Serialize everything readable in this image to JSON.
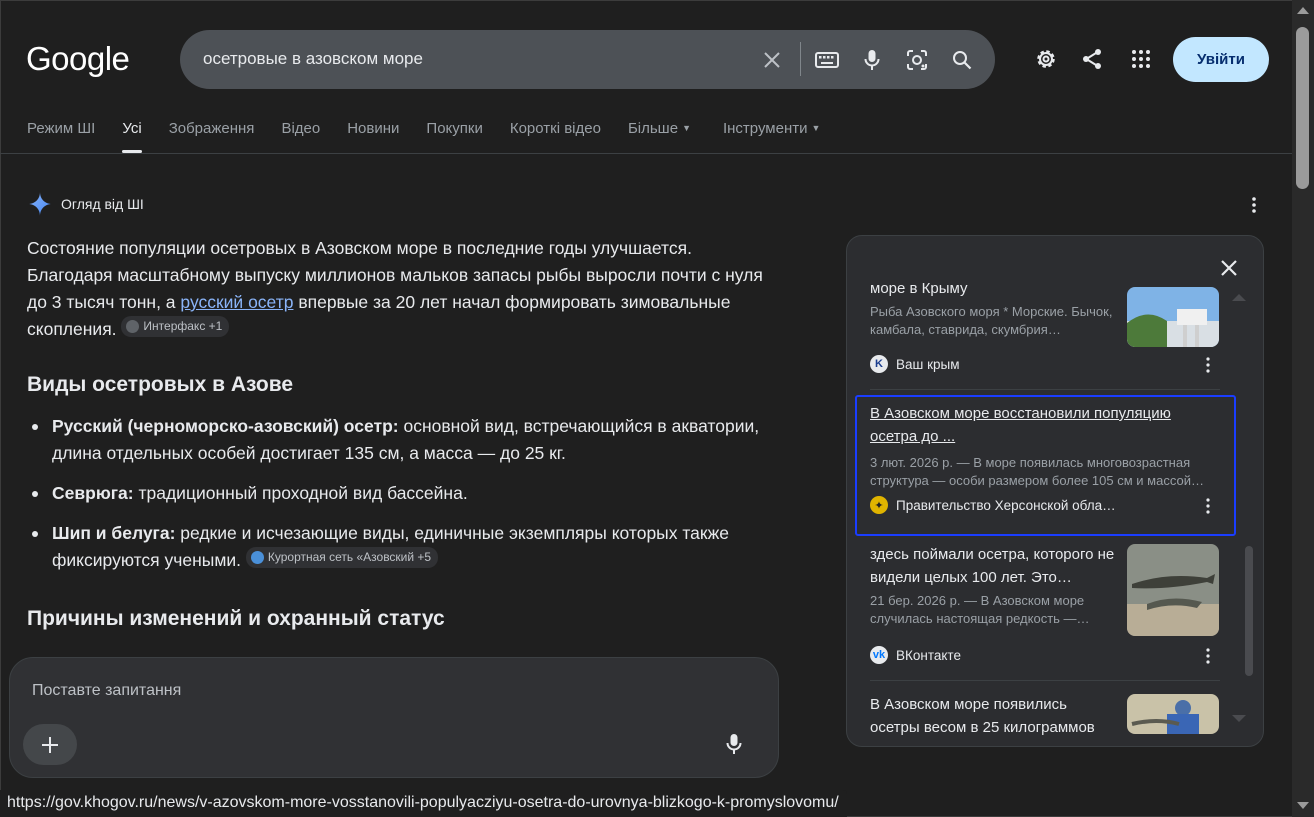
{
  "header": {
    "logo": "Google",
    "query": "осетровые в азовском море",
    "signin_label": "Увійти"
  },
  "tabs": [
    {
      "label": "Режим ШІ"
    },
    {
      "label": "Усі"
    },
    {
      "label": "Зображення"
    },
    {
      "label": "Відео"
    },
    {
      "label": "Новини"
    },
    {
      "label": "Покупки"
    },
    {
      "label": "Короткі відео"
    },
    {
      "label": "Більше"
    },
    {
      "label": "Інструменти"
    }
  ],
  "ai": {
    "heading": "Огляд від ШІ",
    "intro_1": "Состояние популяции осетровых в Азовском море в последние годы улучшается. Благодаря масштабному выпуску миллионов мальков запасы рыбы выросли почти с нуля до 3 тысяч тонн, а ",
    "intro_link": "русский осетр",
    "intro_2": " впервые за 20 лет начал формировать зимовальные скопления.",
    "chip_1": "Интерфакс +1",
    "section_1": "Виды осетровых в Азове",
    "bullets": [
      {
        "bold": "Русский (черноморско-азовский) осетр:",
        "text": " основной вид, встречающийся в акватории, длина отдельных особей достигает 135 см, а масса — до 25 кг."
      },
      {
        "bold": "Севрюга:",
        "text": " традиционный проходной вид бассейна."
      },
      {
        "bold": "Шип и белуга:",
        "text": " редкие и исчезающие виды, единичные экземпляры которых также фиксируются учеными."
      }
    ],
    "chip_2": "Курортная сеть «Азовский +5",
    "section_2": "Причины изменений и охранный статус"
  },
  "ask": {
    "placeholder": "Поставте запитання"
  },
  "panel": {
    "cards": [
      {
        "title": "море в Крыму",
        "snippet": "Рыба Азовского моря * Морские. Бычок, камбала, ставрида, скумбрия…",
        "source": "Ваш крым"
      },
      {
        "title": "В Азовском море восстановили популяцию осетра до ...",
        "snippet": "3 лют. 2026 р. — В море появилась многовозрастная структура — особи размером более 105 см и массой…",
        "source": "Правительство Херсонской обла…"
      },
      {
        "title": "здесь поймали осетра, которого не видели целых 100 лет. Это…",
        "snippet": "21 бер. 2026 р. — В Азовском море случилась настоящая редкость —…",
        "source": "ВКонтакте"
      },
      {
        "title": "В Азовском море появились осетры весом в 25 килограммов",
        "snippet": "",
        "source": ""
      }
    ]
  },
  "status_url": "https://gov.khogov.ru/news/v-azovskom-more-vosstanovili-populyacziyu-osetra-do-urovnya-blizkogo-k-promyslovomu/",
  "colors": {
    "background": "#1f1f1f",
    "accent_link": "#8ab4f8",
    "signin_bg": "#c2e7ff",
    "focus_outline": "#1a3dff"
  },
  "icons": [
    "clear-icon",
    "keyboard-icon",
    "mic-icon",
    "lens-icon",
    "search-icon",
    "settings-icon",
    "share-icon",
    "apps-icon",
    "sparkle-icon",
    "more-vert-icon",
    "close-icon",
    "plus-icon"
  ]
}
